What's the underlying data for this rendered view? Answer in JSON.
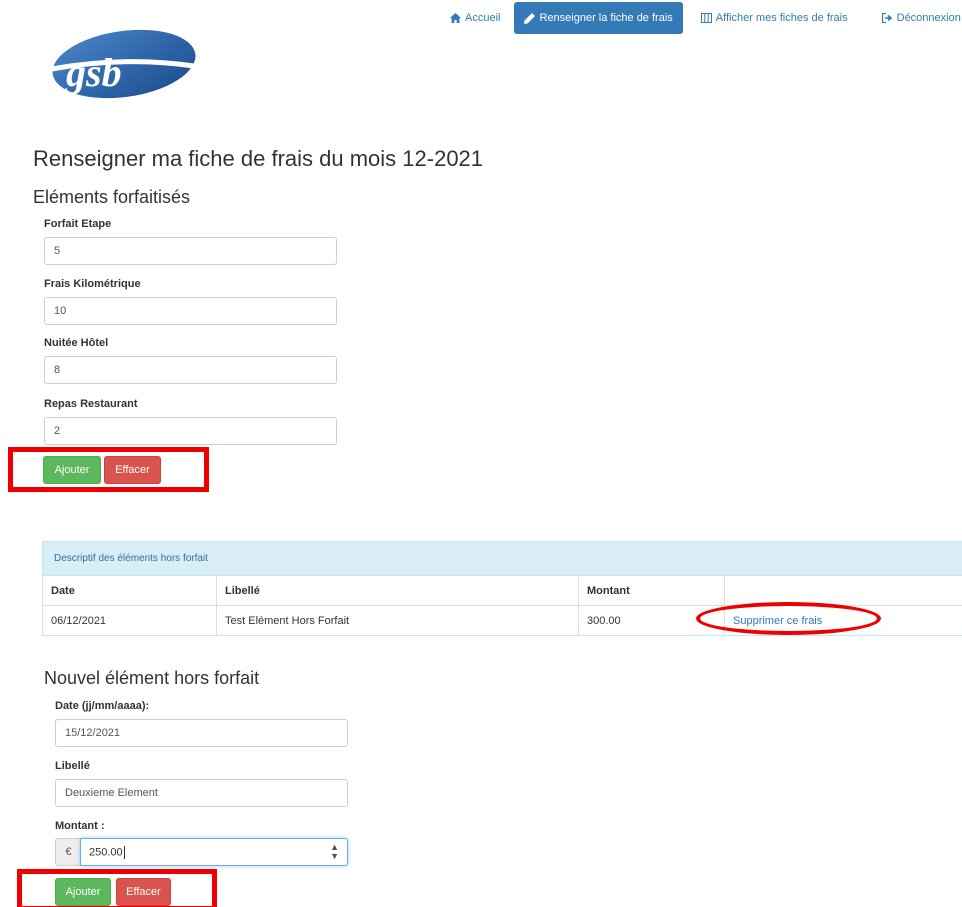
{
  "nav": {
    "accueil": "Accueil",
    "renseigner": "Renseigner la fiche de frais",
    "afficher": "Afficher mes fiches de frais",
    "deconnexion": "Déconnexion"
  },
  "logo": {
    "text": "gsb"
  },
  "page": {
    "title": "Renseigner ma fiche de frais du mois 12-2021",
    "section_forfait": "Eléments forfaitisés",
    "section_nouvel": "Nouvel élément hors forfait"
  },
  "forfait": {
    "etape_label": "Forfait Etape",
    "etape_value": "5",
    "km_label": "Frais Kilométrique",
    "km_value": "10",
    "nuitee_label": "Nuitée Hôtel",
    "nuitee_value": "8",
    "repas_label": "Repas Restaurant",
    "repas_value": "2",
    "ajouter": "Ajouter",
    "effacer": "Effacer"
  },
  "hors_forfait_table": {
    "heading": "Descriptif des éléments hors forfait",
    "columns": [
      "Date",
      "Libellé",
      "Montant",
      ""
    ],
    "rows": [
      {
        "date": "06/12/2021",
        "libelle": "Test Elément Hors Forfait",
        "montant": "300.00",
        "action": "Supprimer ce frais"
      }
    ]
  },
  "nouvel": {
    "date_label": "Date (jj/mm/aaaa):",
    "date_value": "15/12/2021",
    "libelle_label": "Libellé",
    "libelle_value": "Deuxieme Element",
    "montant_label": "Montant :",
    "currency": "€",
    "montant_value": "250.00",
    "ajouter": "Ajouter",
    "effacer": "Effacer"
  },
  "colors": {
    "primary": "#337ab7",
    "success": "#5cb85c",
    "danger": "#d9534f",
    "highlight": "#ee0000",
    "panel_info": "#d9edf7"
  }
}
